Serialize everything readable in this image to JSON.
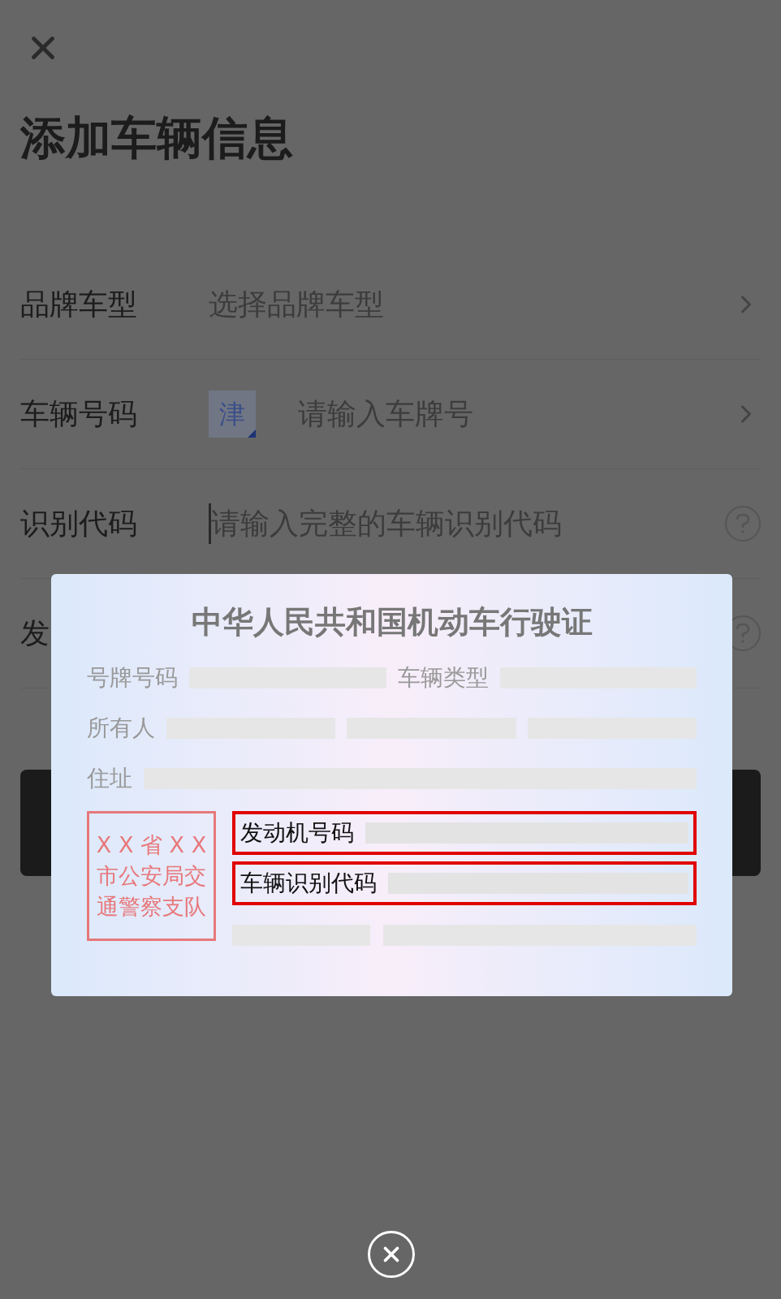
{
  "title": "添加车辆信息",
  "rows": [
    {
      "kind": "select",
      "label": "品牌车型",
      "placeholder": "选择品牌车型"
    },
    {
      "kind": "plate",
      "label": "车辆号码",
      "province": "津",
      "placeholder": "请输入车牌号"
    },
    {
      "kind": "help",
      "label": "识别代码",
      "placeholder": "请输入完整的车辆识别代码",
      "focused": true
    },
    {
      "kind": "help",
      "label": "发",
      "focused": false
    }
  ],
  "license": {
    "title": "中华人民共和国机动车行驶证",
    "lines": [
      [
        {
          "label": "号牌号码",
          "kind": "single"
        },
        {
          "label": "车辆类型",
          "kind": "single"
        }
      ],
      [
        {
          "label": "所有人",
          "kind": "split"
        }
      ],
      [
        {
          "label": "住址",
          "kind": "single"
        }
      ]
    ],
    "stamp": [
      "X X 省 X X",
      "市公安局交",
      "通警察支队"
    ],
    "fields": [
      {
        "label": "发动机号码",
        "highlighted": true
      },
      {
        "label": "车辆识别代码",
        "highlighted": true
      }
    ]
  }
}
